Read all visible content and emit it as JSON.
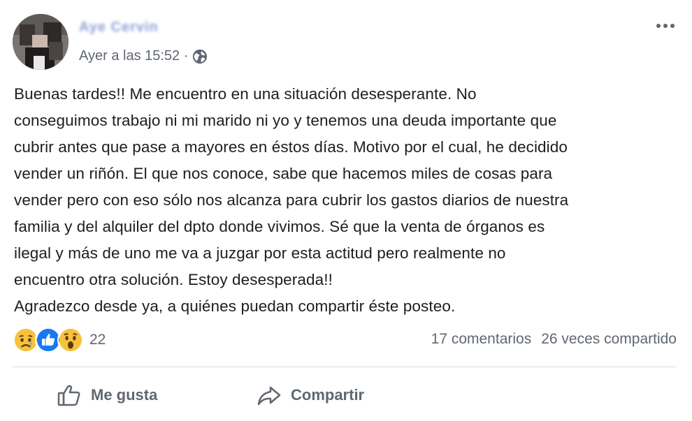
{
  "post": {
    "author_name": "Aye Cervin",
    "timestamp": "Ayer a las 15:52 ·",
    "privacy_icon": "globe-icon",
    "menu_icon": "more-options-icon",
    "text_lines": [
      "Buenas tardes!! Me encuentro en una situación desesperante. No",
      "conseguimos trabajo ni mi marido ni yo y tenemos una deuda importante que",
      "cubrir antes que pase a mayores en éstos días. Motivo por el cual, he decidido",
      "vender un riñón. El que nos conoce, sabe que hacemos miles de cosas para",
      "vender pero con eso sólo nos alcanza para cubrir los gastos diarios de nuestra",
      "familia y del alquiler del dpto donde vivimos. Sé que la venta de órganos es",
      "ilegal y más de uno me va a juzgar por esta actitud pero realmente no",
      "encuentro otra solución. Estoy desesperada!!",
      "Agradezco desde ya, a quiénes puedan compartir éste posteo."
    ]
  },
  "reactions": {
    "icons": [
      "sad-reaction-icon",
      "like-reaction-icon",
      "wow-reaction-icon"
    ],
    "count": "22"
  },
  "stats": {
    "comments": "17 comentarios",
    "shares": "26 veces compartido"
  },
  "actions": {
    "like_label": "Me gusta",
    "share_label": "Compartir"
  },
  "colors": {
    "secondary_text": "#606770",
    "like_blue": "#1877f2",
    "reaction_yellow": "#f7c23b",
    "divider": "#dadde1"
  }
}
